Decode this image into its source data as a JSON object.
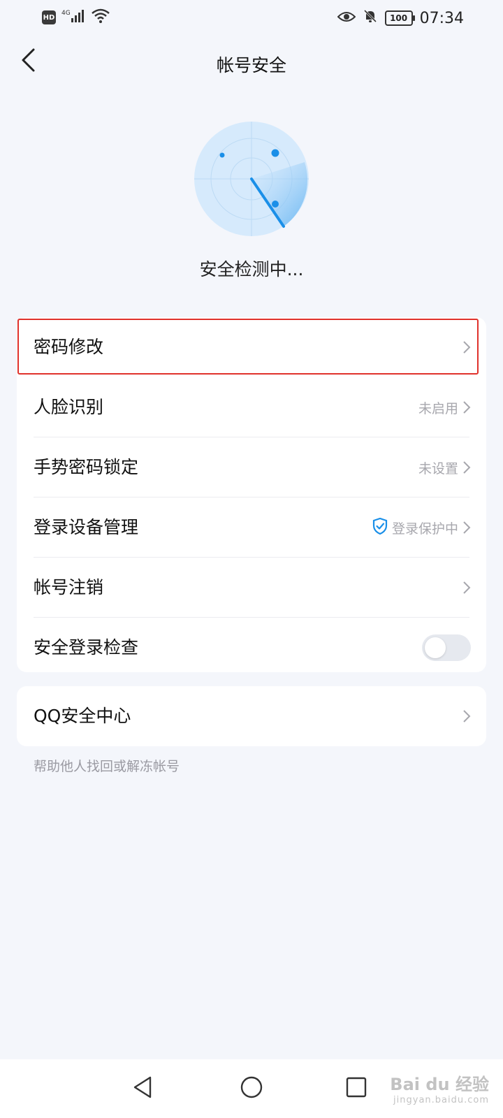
{
  "status_bar": {
    "hd": "HD",
    "network": "4G",
    "battery": "100",
    "time": "07:34"
  },
  "header": {
    "title": "帐号安全",
    "back_icon": "chevron-left-icon"
  },
  "radar": {
    "status_text": "安全检测中..."
  },
  "settings": {
    "items": [
      {
        "label": "密码修改",
        "value": ""
      },
      {
        "label": "人脸识别",
        "value": "未启用"
      },
      {
        "label": "手势密码锁定",
        "value": "未设置"
      },
      {
        "label": "登录设备管理",
        "value": "登录保护中",
        "icon": "shield-check-icon"
      },
      {
        "label": "帐号注销",
        "value": ""
      },
      {
        "label": "安全登录检查",
        "toggle_on": false
      }
    ]
  },
  "qq_security": {
    "label": "QQ安全中心",
    "helper": "帮助他人找回或解冻帐号"
  },
  "watermark": {
    "text": "Bai du 经验",
    "sub": "jingyan.baidu.com"
  },
  "colors": {
    "accent_blue": "#1a8fe8",
    "highlight_red": "#e0322c",
    "page_bg": "#f4f6fb"
  }
}
